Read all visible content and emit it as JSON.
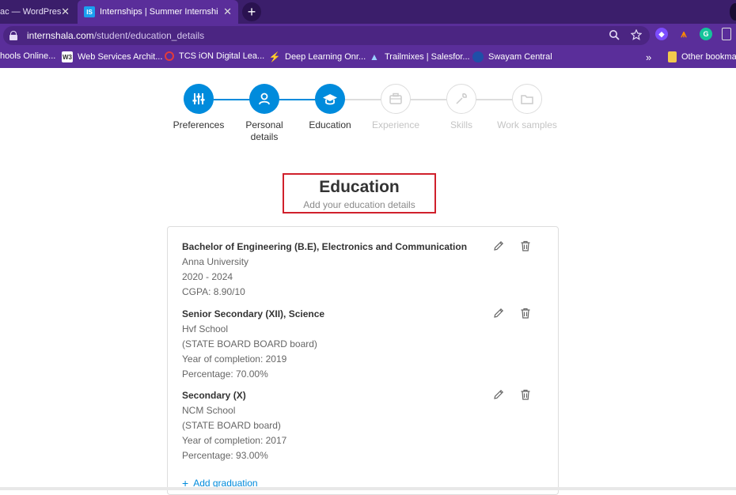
{
  "browser": {
    "tabs": [
      {
        "title": "ac — WordPress",
        "close": "✕"
      },
      {
        "title": "Internships | Summer Internship",
        "favicon": "IS",
        "close": "✕"
      }
    ],
    "new_tab": "+",
    "url_host": "internshala.com",
    "url_path": "/student/education_details",
    "bookmarks": [
      {
        "label": "hools Online..."
      },
      {
        "label": "Web Services Archit...",
        "icon": "W3"
      },
      {
        "label": "TCS iON Digital Lea..."
      },
      {
        "label": "Deep Learning Onr..."
      },
      {
        "label": "Trailmixes | Salesfor..."
      },
      {
        "label": "Swayam Central"
      }
    ],
    "bookmarks_more": "»",
    "other_bookmarks": "Other bookmarks"
  },
  "stepper": {
    "steps": [
      {
        "label": "Preferences",
        "state": "done",
        "icon": "sliders-icon"
      },
      {
        "label": "Personal details",
        "state": "done",
        "icon": "person-icon"
      },
      {
        "label": "Education",
        "state": "done",
        "icon": "graduation-cap-icon"
      },
      {
        "label": "Experience",
        "state": "todo",
        "icon": "briefcase-icon"
      },
      {
        "label": "Skills",
        "state": "todo",
        "icon": "wrench-icon"
      },
      {
        "label": "Work samples",
        "state": "todo",
        "icon": "folder-icon"
      }
    ]
  },
  "page": {
    "title": "Education",
    "subtitle": "Add your education details"
  },
  "education": [
    {
      "title": "Bachelor of Engineering (B.E), Electronics and Communication",
      "lines": [
        "Anna University",
        "2020 - 2024",
        "CGPA: 8.90/10"
      ]
    },
    {
      "title": "Senior Secondary (XII), Science",
      "lines": [
        "Hvf School",
        "(STATE BOARD BOARD board)",
        "Year of completion: 2019",
        "Percentage: 70.00%"
      ]
    },
    {
      "title": "Secondary (X)",
      "lines": [
        "NCM School",
        "(STATE BOARD board)",
        "Year of completion: 2017",
        "Percentage: 93.00%"
      ]
    }
  ],
  "add_graduation": "Add graduation",
  "colors": {
    "accent": "#008bdc",
    "browser_purple": "#5a2e9a",
    "highlight_red": "#d0202c"
  }
}
